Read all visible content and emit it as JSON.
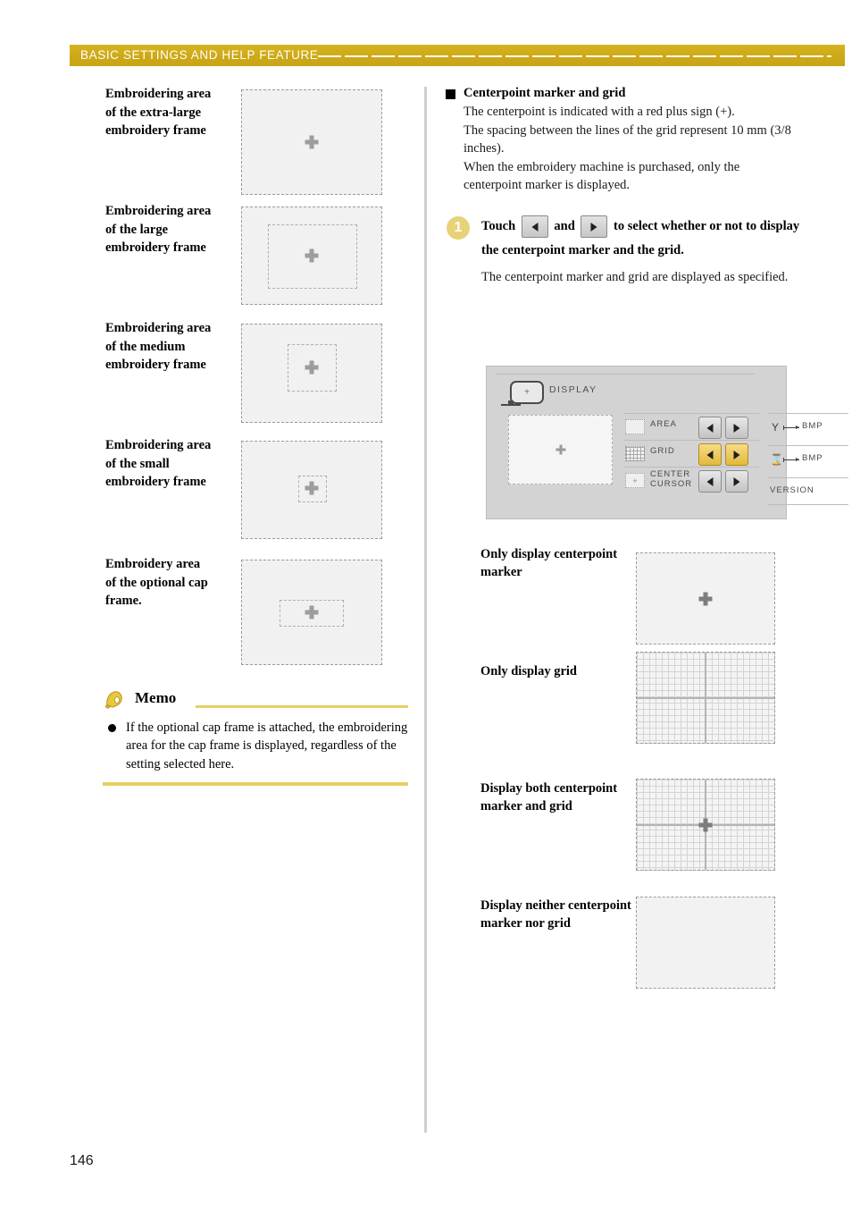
{
  "header": {
    "title": "BASIC SETTINGS AND HELP FEATURE"
  },
  "left_column": {
    "frames": [
      {
        "label": "Embroidering area of the extra-large embroidery frame",
        "has_inner_box": false
      },
      {
        "label": "Embroidering area of the large embroidery frame",
        "has_inner_box": true
      },
      {
        "label": "Embroidering area of the medium embroidery frame",
        "has_inner_box": true
      },
      {
        "label": "Embroidering area of the small embroidery frame",
        "has_inner_box": true
      },
      {
        "label": "Embroidery area of the optional cap frame.",
        "has_inner_box": true
      }
    ]
  },
  "memo": {
    "title": "Memo",
    "icon": "bell-icon",
    "items": [
      "If the optional cap frame is attached, the embroidering area for the cap frame is displayed, regardless of the setting selected here."
    ]
  },
  "right_column": {
    "section": {
      "heading": "Centerpoint marker and grid",
      "paragraphs": [
        "The centerpoint is indicated with a red plus sign (+).",
        "The spacing between the lines of the grid represent 10 mm (3/8 inches).",
        "When the embroidery machine is purchased, only the centerpoint marker is displayed."
      ]
    },
    "step": {
      "number": "1",
      "text_before": "Touch",
      "text_middle": "and",
      "text_after": "to select whether or not to display the centerpoint marker and the grid.",
      "left_key_icon": "arrow-left-icon",
      "right_key_icon": "arrow-right-icon",
      "result": "The centerpoint marker and grid are displayed as specified."
    },
    "examples": [
      {
        "label": "Only display centerpoint marker",
        "grid": false,
        "marker": true
      },
      {
        "label": "Only display grid",
        "grid": true,
        "marker": false
      },
      {
        "label": "Display both centerpoint marker and grid",
        "grid": true,
        "marker": true
      },
      {
        "label": "Display neither centerpoint marker nor grid",
        "grid": false,
        "marker": false
      }
    ]
  },
  "machine_panel": {
    "screen_title": "DISPLAY",
    "screen_icon": "display-monitor-icon",
    "preview_marker": "plus-marker",
    "settings": [
      {
        "label": "AREA",
        "swatch": "frame-swatch-icon",
        "left_button": "arrow-left-icon",
        "right_button": "arrow-right-icon",
        "active": false
      },
      {
        "label": "GRID",
        "swatch": "grid-swatch-icon",
        "left_button": "arrow-left-icon",
        "right_button": "arrow-right-icon",
        "active": true
      },
      {
        "label": "CENTER CURSOR",
        "swatch": "center-cursor-swatch-icon",
        "left_button": "arrow-left-icon",
        "right_button": "arrow-right-icon",
        "active": false
      }
    ],
    "side_items": [
      {
        "label": "BMP",
        "icon": "needle-icon"
      },
      {
        "label": "BMP",
        "icon": "hourglass-icon"
      },
      {
        "label": "VERSION",
        "icon": ""
      }
    ],
    "accent_color": "#e2b93c"
  },
  "footer": {
    "page_number": "146"
  },
  "colors": {
    "header_bar": "#cda918",
    "memo_rule": "#e8cf63",
    "step_badge": "#e8d278",
    "panel_bg": "#d3d3d3"
  }
}
